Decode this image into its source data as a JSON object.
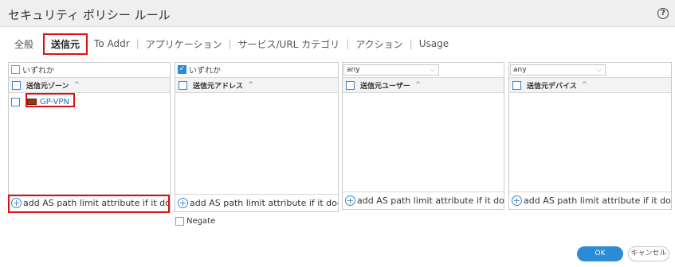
{
  "dialog": {
    "title": "セキュリティ ポリシー ルール",
    "help_icon": "help-icon",
    "help_glyph": "?"
  },
  "tabs": [
    {
      "label": "全般"
    },
    {
      "label": "送信元",
      "active": true
    },
    {
      "label": "To Addr"
    },
    {
      "label": "アプリケーション"
    },
    {
      "label": "サービス/URL カテゴリ"
    },
    {
      "label": "アクション"
    },
    {
      "label": "Usage"
    }
  ],
  "tab_separator": "|",
  "panels": {
    "source_zone": {
      "any_label": "いずれか",
      "column_header": "送信元ゾーン",
      "rows": [
        {
          "label": "GP-VPN",
          "icon": "zone-icon"
        }
      ],
      "footer": "add AS path limit attribute if it does not"
    },
    "source_address": {
      "any_label": "いずれか",
      "column_header": "送信元アドレス",
      "footer": "add AS path limit attribute if it does not"
    },
    "source_user": {
      "dropdown_value": "any",
      "column_header": "送信元ユーザー",
      "footer": "add AS path limit attribute if it does not"
    },
    "source_device": {
      "dropdown_value": "any",
      "column_header": "送信元デバイス",
      "footer": "add AS path limit attribute if it does not"
    }
  },
  "glyphs": {
    "plus": "+",
    "sort_caret": "^",
    "check": "✓",
    "dropdown_chevron": "⌵"
  },
  "negate_label": "Negate",
  "buttons": {
    "ok": "OK",
    "cancel": "キャンセル"
  },
  "colors": {
    "accent": "#2b8bd6",
    "highlight": "#dd1111",
    "link": "#1e6fb8"
  }
}
